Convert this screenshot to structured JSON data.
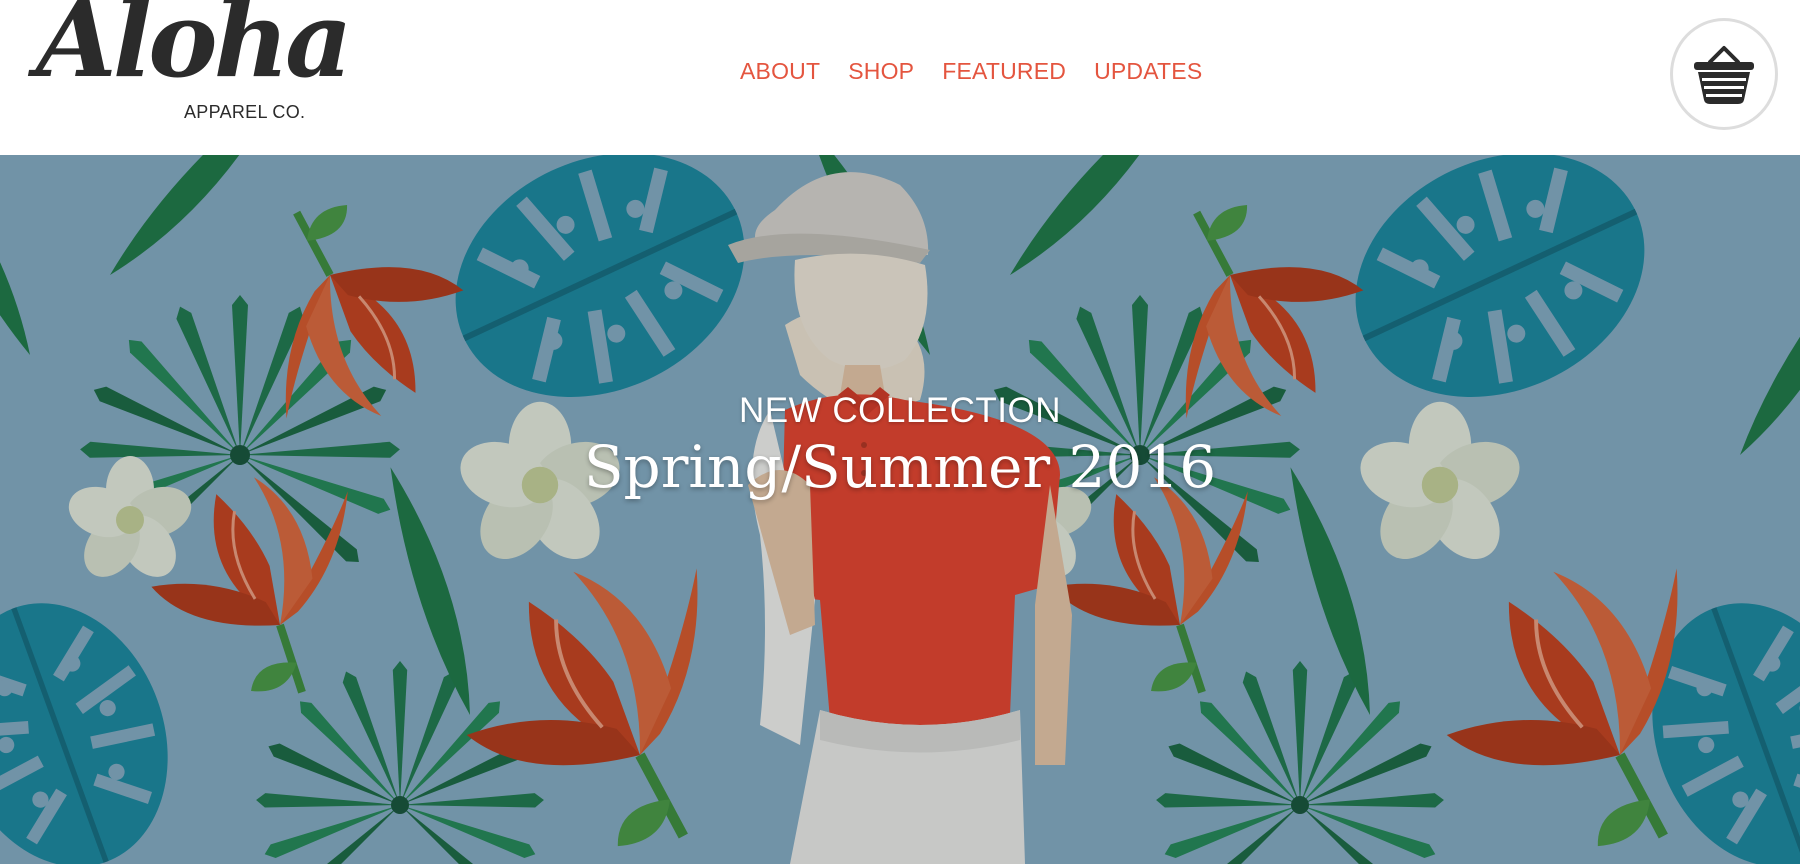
{
  "brand": {
    "script": "Aloha",
    "subtitle": "APPAREL CO."
  },
  "nav": {
    "items": [
      "ABOUT",
      "SHOP",
      "FEATURED",
      "UPDATES"
    ]
  },
  "cart": {
    "icon": "basket-icon"
  },
  "hero": {
    "eyebrow": "NEW COLLECTION",
    "headline": "Spring/Summer 2016"
  },
  "colors": {
    "accent": "#e4553f",
    "logo": "#2b2b2b",
    "hero_bg": "#86aec4",
    "leaf_green": "#1f7a4d",
    "leaf_teal": "#1a8aa0",
    "flower_red": "#d2461f",
    "flower_white": "#e8eedf",
    "shirt": "#e8442c",
    "pants": "#eeeeea"
  }
}
